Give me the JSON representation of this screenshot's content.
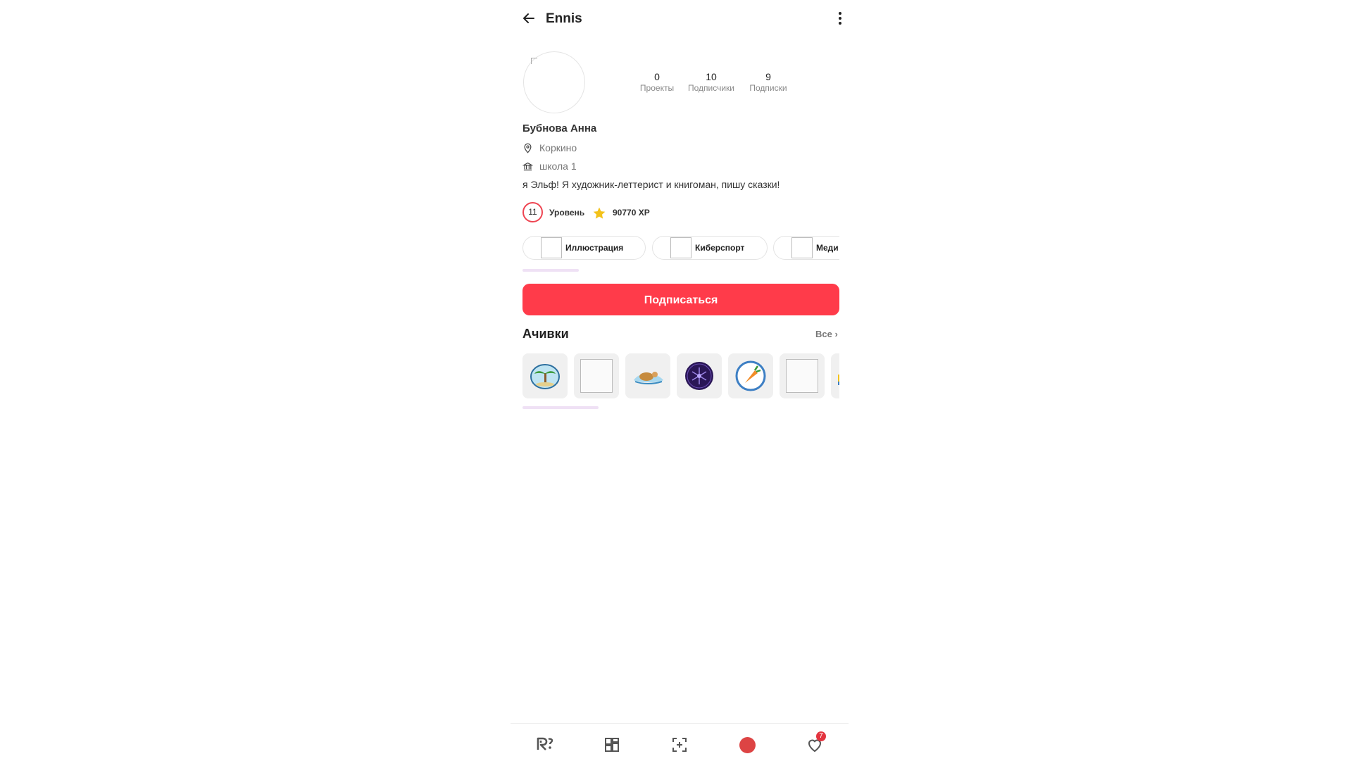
{
  "header": {
    "title": "Ennis"
  },
  "stats": [
    {
      "value": "0",
      "label": "Проекты"
    },
    {
      "value": "10",
      "label": "Подписчики"
    },
    {
      "value": "9",
      "label": "Подписки"
    }
  ],
  "profile": {
    "full_name": "Бубнова Анна",
    "city": "Коркино",
    "school": "школа 1",
    "bio": "я Эльф! Я художник-леттерист и книгоман, пишу сказки!"
  },
  "level": {
    "number": "11",
    "label": "Уровень",
    "xp": "90770 XP"
  },
  "interests": [
    "Иллюстрация",
    "Киберспорт",
    "Меди"
  ],
  "subscribe_label": "Подписаться",
  "achievements": {
    "title": "Ачивки",
    "all_label": "Все ›",
    "icons": [
      "palm-tree-badge",
      "image-placeholder",
      "sea-turtle-badge",
      "network-badge",
      "carrot-badge",
      "image-placeholder",
      "people-badge"
    ]
  },
  "nav": {
    "items": [
      "home-r-logo-icon",
      "grid-icon",
      "add-scan-icon",
      "profile-avatar",
      "heart-icon"
    ],
    "notifications_count": "7"
  },
  "colors": {
    "accent": "#ff3b4a",
    "level_ring": "#ee4552",
    "scroll_indicator": "#efe1f5"
  }
}
